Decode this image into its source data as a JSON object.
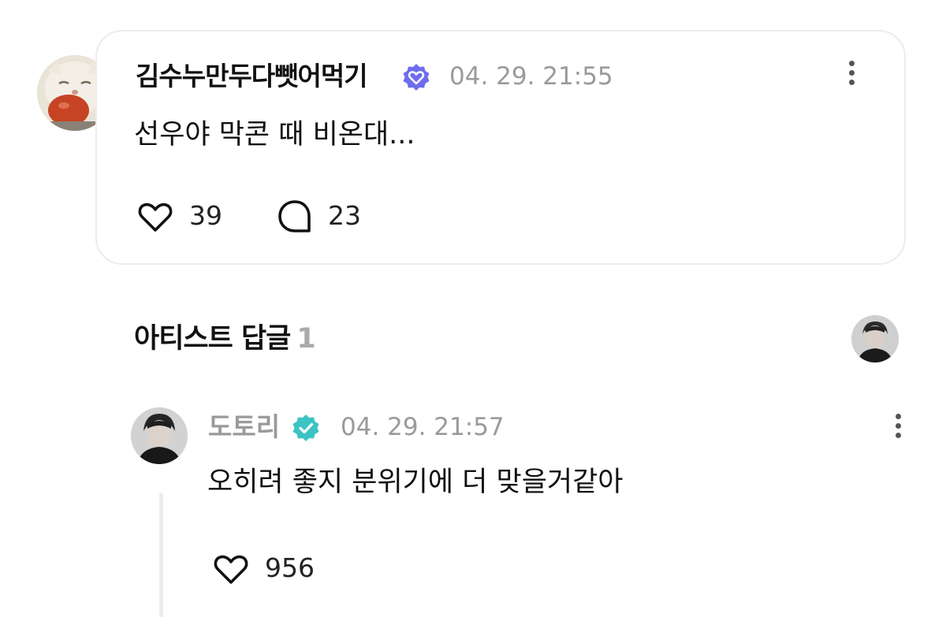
{
  "post": {
    "username": "김수누만두다뺏어먹기",
    "timestamp": "04. 29. 21:55",
    "text": "선우야 막콘 때 비온대...",
    "likes": "39",
    "comments": "23"
  },
  "artist_replies": {
    "title": "아티스트 답글",
    "count": "1"
  },
  "reply": {
    "username": "도토리",
    "timestamp": "04. 29. 21:57",
    "text": "오히려 좋지 분위기에 더 맞을거같아",
    "likes": "956"
  },
  "colors": {
    "user_badge": "#6f6cf0",
    "artist_badge": "#3cc3c3",
    "muted_text": "#9a9a9a",
    "card_border": "#ececec"
  },
  "icons": {
    "user_badge": "verified-heart-badge-icon",
    "artist_badge": "verified-check-badge-icon",
    "like": "heart-outline-icon",
    "comment": "speech-bubble-icon",
    "more": "more-vertical-icon"
  }
}
